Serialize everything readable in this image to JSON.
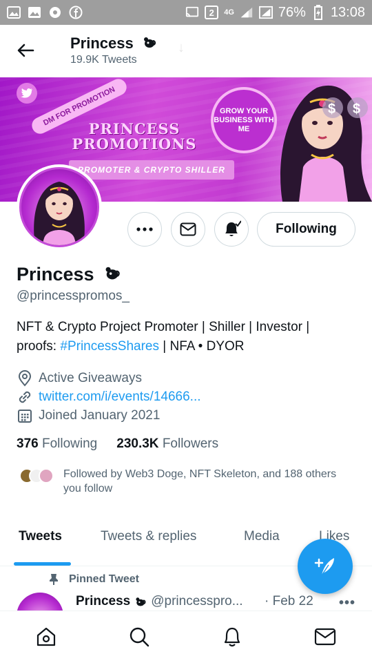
{
  "status_bar": {
    "signal": "4G",
    "sim_badge": "2",
    "battery": "76%",
    "time": "13:08"
  },
  "header": {
    "title": "Princess",
    "tweet_count": "19.9K Tweets"
  },
  "banner": {
    "title": "PRINCESS PROMOTIONS",
    "tagline": "PROMOTER & CRYPTO SHILLER",
    "side_tag": "DM FOR PROMOTION",
    "circle_text": "GROW YOUR BUSINESS WITH ME"
  },
  "actions": {
    "follow_label": "Following"
  },
  "profile": {
    "name": "Princess",
    "handle": "@princesspromos_",
    "bio_line1": "NFT & Crypto Project Promoter | Shiller | Investor |",
    "bio_prefix": "proofs: ",
    "bio_hashtag": "#PrincessShares",
    "bio_suffix": " | NFA • DYOR",
    "location": "Active Giveaways",
    "website": "twitter.com/i/events/14666...",
    "joined": "Joined January 2021",
    "following_count": "376",
    "following_label": "Following",
    "followers_count": "230.3K",
    "followers_label": "Followers",
    "followed_by": "Followed by Web3 Doge, NFT Skeleton, and 188 others you follow"
  },
  "tabs": [
    {
      "label": "Tweets",
      "active": true
    },
    {
      "label": "Tweets & replies",
      "active": false
    },
    {
      "label": "Media",
      "active": false
    },
    {
      "label": "Likes",
      "active": false
    }
  ],
  "pinned_tweet": {
    "pinned_label": "Pinned Tweet",
    "author": "Princess",
    "handle": "@princesspro...",
    "date": "· Feb 22"
  },
  "colors": {
    "accent": "#1d9bf0",
    "text": "#0f1419",
    "muted": "#536471",
    "banner": "#c23ad1"
  }
}
